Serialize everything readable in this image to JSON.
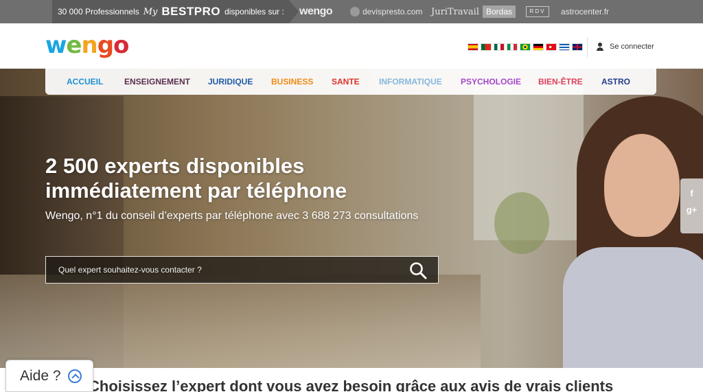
{
  "network": {
    "prefix": "30 000 Professionnels",
    "my": "My",
    "bestpro": "BESTPRO",
    "suffix": "disponibles sur :",
    "sites": [
      "wengo",
      "devispresto.com",
      "JuriTravail",
      "Bordas",
      "RDV",
      "astrocenter.fr"
    ]
  },
  "header": {
    "logo": [
      "w",
      "e",
      "n",
      "g",
      "o"
    ],
    "flags": [
      "es",
      "pt",
      "mx",
      "it",
      "br",
      "de",
      "tr",
      "gr",
      "gb"
    ],
    "login_label": "Se connecter"
  },
  "nav": {
    "items": [
      {
        "label": "ACCUEIL",
        "color": "#1a8fd6"
      },
      {
        "label": "ENSEIGNEMENT",
        "color": "#5b2e4f"
      },
      {
        "label": "JURIDIQUE",
        "color": "#1f5ba8"
      },
      {
        "label": "BUSINESS",
        "color": "#f08a12"
      },
      {
        "label": "SANTE",
        "color": "#e0312a"
      },
      {
        "label": "INFORMATIQUE",
        "color": "#86b6de"
      },
      {
        "label": "PSYCHOLOGIE",
        "color": "#a546c9"
      },
      {
        "label": "BIEN-ÊTRE",
        "color": "#e0405a"
      },
      {
        "label": "ASTRO",
        "color": "#233b8a"
      }
    ]
  },
  "hero": {
    "headline_line1": "2 500 experts disponibles",
    "headline_line2": "immédiatement par téléphone",
    "subline": "Wengo, n°1 du conseil d’experts par téléphone avec 3 688 273 consultations",
    "search_placeholder": "Quel expert souhaitez-vous contacter ?"
  },
  "social": {
    "facebook": "f",
    "google": "g+"
  },
  "bottom": {
    "heading": "Choisissez l’expert dont vous avez besoin grâce aux avis de vrais clients"
  },
  "help": {
    "label": "Aide ?"
  }
}
